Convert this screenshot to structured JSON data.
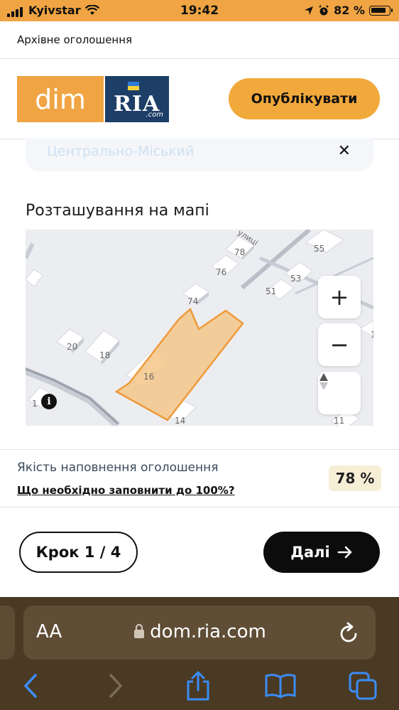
{
  "status_bar": {
    "carrier": "Kyivstar",
    "time": "19:42",
    "battery": "82 %"
  },
  "page_header": {
    "title": "Архівне оголошення"
  },
  "logo": {
    "dim": "dim",
    "ria": "RIA",
    "com": ".com"
  },
  "header": {
    "publish_label": "Опублікувати"
  },
  "district": {
    "value": "Центрально-Міський",
    "clear_icon": "close-icon"
  },
  "map_section": {
    "label": "Розташування на мапі",
    "street_label": "улиці",
    "building_numbers": [
      "78",
      "55",
      "76",
      "53",
      "51",
      "74",
      "1",
      "20",
      "18",
      "16",
      "1",
      "14",
      "11"
    ],
    "zoom_in": "+",
    "zoom_out": "−",
    "info": "i"
  },
  "quality": {
    "title": "Якість наповнення оголошення",
    "link": "Що необхідно заповнити до 100%?",
    "percent": "78 %"
  },
  "footer": {
    "step_label": "Крок 1 / 4",
    "next_label": "Далі"
  },
  "browser": {
    "aa": "AA",
    "url": "dom.ria.com"
  },
  "colors": {
    "accent": "#f0a443",
    "logo_blue": "#1d3e66",
    "parcel_fill": "#f4c98f",
    "parcel_stroke": "#ee9a3a",
    "safari_bg": "#4a3a23"
  }
}
